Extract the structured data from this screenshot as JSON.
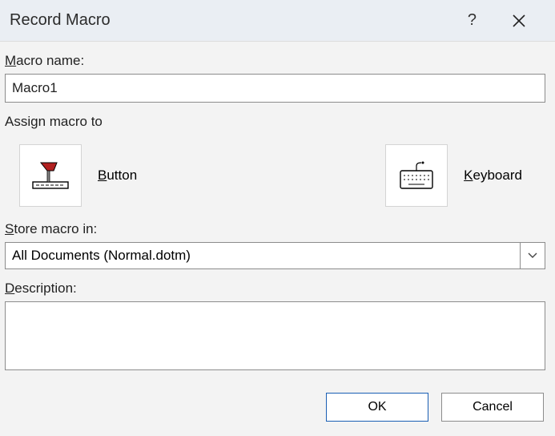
{
  "titlebar": {
    "title": "Record Macro",
    "help": "?",
    "close": "×"
  },
  "labels": {
    "macro_name": "acro name:",
    "macro_name_u": "M",
    "assign_to": "Assign macro to",
    "button_label": "utton",
    "button_u": "B",
    "keyboard_label": "eyboard",
    "keyboard_u": "K",
    "store_in": "tore macro in:",
    "store_in_u": "S",
    "description": "escription:",
    "description_u": "D"
  },
  "values": {
    "macro_name": "Macro1",
    "store_in": "All Documents (Normal.dotm)",
    "description": ""
  },
  "footer": {
    "ok": "OK",
    "cancel": "Cancel"
  }
}
